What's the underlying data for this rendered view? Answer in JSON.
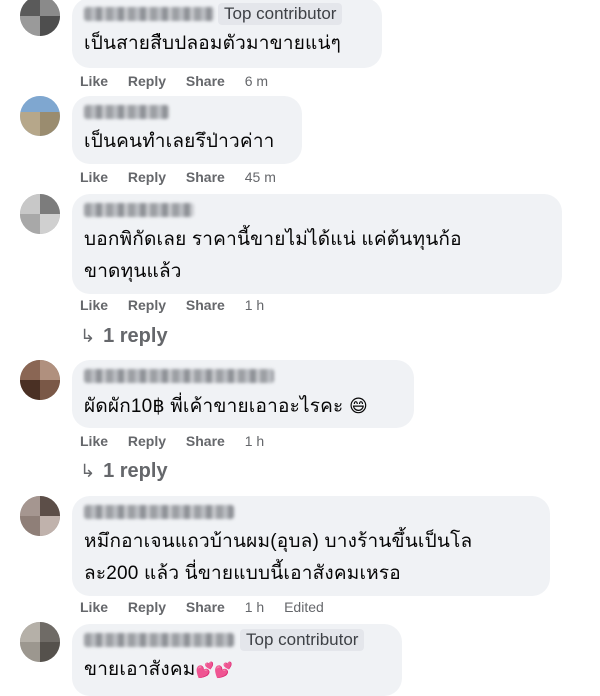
{
  "comments": [
    {
      "badge": "Top contributor",
      "text_lines": [
        "เป็นสายสืบปลอมตัวมาขายแน่ๆ"
      ],
      "actions": {
        "like": "Like",
        "reply": "Reply",
        "share": "Share",
        "time": "6 m"
      }
    },
    {
      "text_lines": [
        "เป็นคนทำเลยรึป่าวค่าา"
      ],
      "actions": {
        "like": "Like",
        "reply": "Reply",
        "share": "Share",
        "time": "45 m"
      }
    },
    {
      "text_lines": [
        "บอกพิกัดเลย ราคานี้ขายไม่ได้แน่ แค่ต้นทุนก้อ",
        "ขาดทุนแล้ว"
      ],
      "actions": {
        "like": "Like",
        "reply": "Reply",
        "share": "Share",
        "time": "1 h"
      },
      "replies": "1 reply"
    },
    {
      "text_lines": [
        "ผัดผัก10฿ พี่เค้าขายเอาอะไรคะ"
      ],
      "emoji": "😄",
      "actions": {
        "like": "Like",
        "reply": "Reply",
        "share": "Share",
        "time": "1 h"
      },
      "replies": "1 reply"
    },
    {
      "text_lines": [
        "หมึกอาเจนแถวบ้านผม(อุบล) บางร้านขึ้นเป็นโล",
        "ละ200 แล้ว นี่ขายแบบนี้เอาสังคมเหรอ"
      ],
      "actions": {
        "like": "Like",
        "reply": "Reply",
        "share": "Share",
        "time": "1 h",
        "edited": "Edited"
      }
    },
    {
      "badge": "Top contributor",
      "text_lines": [
        "ขายเอาสังคม"
      ],
      "hearts": "💕💕"
    }
  ],
  "reply_arrow": "↳"
}
